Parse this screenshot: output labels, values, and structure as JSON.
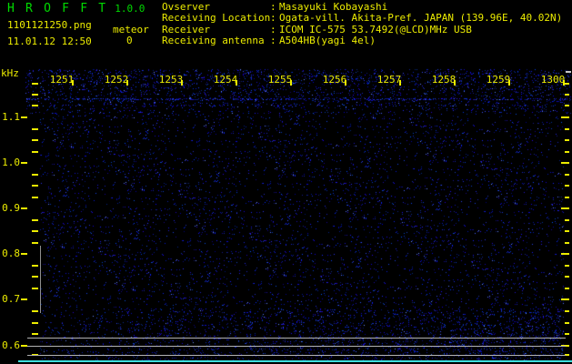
{
  "header": {
    "app_title": "H R O F F T",
    "version": "1.0.0",
    "filename": "1101121250.png",
    "mode_label": "meteor",
    "datetime": "11.01.12 12:50",
    "echo_count": "0",
    "info_rows": [
      {
        "label": "Ovserver",
        "sep": ":",
        "value": "Masayuki Kobayashi"
      },
      {
        "label": "Receiving Location",
        "sep": ":",
        "value": "Ogata-vill. Akita-Pref. JAPAN (139.96E, 40.02N)"
      },
      {
        "label": "Receiver",
        "sep": ":",
        "value": "ICOM IC-575 53.7492(@LCD)MHz USB"
      },
      {
        "label": "Receiving antenna",
        "sep": ":",
        "value": "A504HB(yagi 4el)"
      }
    ]
  },
  "spectrogram": {
    "freq_axis": {
      "unit": "kHz",
      "tick_labels": [
        "1.1",
        "1.0",
        "0.9",
        "0.8",
        "0.7",
        "0.6"
      ]
    },
    "time_axis": {
      "tick_labels": [
        "1251",
        "1252",
        "1253",
        "1254",
        "1255",
        "1256",
        "1257",
        "1258",
        "1259",
        "1300"
      ]
    }
  },
  "colors": {
    "title_green": "#00db00",
    "text_yellow": "#ecec00",
    "noise_blue": "#2222cc",
    "marker_gray": "#b2b2b2",
    "band_marker_gray": "#8f8f8f",
    "baseline_cyan": "#3edede",
    "background": "#000000"
  }
}
